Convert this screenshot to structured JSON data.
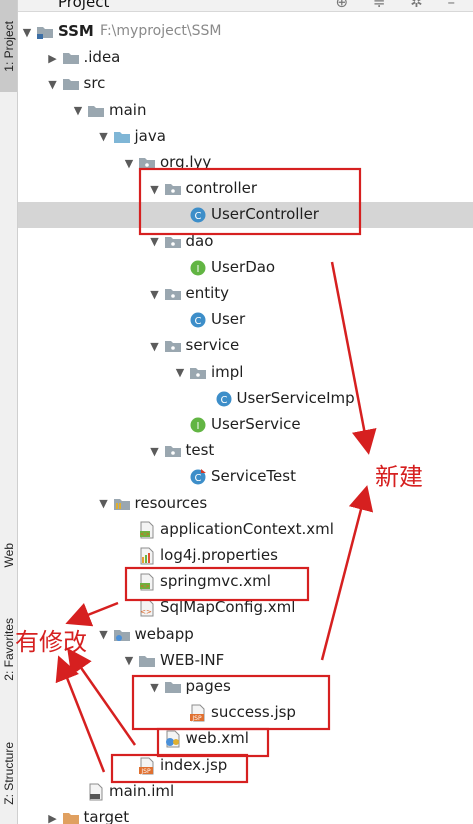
{
  "sidebar": {
    "tabs": [
      {
        "label": "1: Project",
        "icon": "folder-icon",
        "active": true
      },
      {
        "label": "Web",
        "icon": "web-icon",
        "active": false
      },
      {
        "label": "2: Favorites",
        "icon": "star-icon",
        "active": false
      },
      {
        "label": "Z: Structure",
        "icon": "structure-icon",
        "active": false
      }
    ]
  },
  "header": {
    "title": "Project",
    "icons": [
      "locate-icon",
      "collapse-icon",
      "gear-icon",
      "hide-icon"
    ]
  },
  "tree": [
    {
      "label": "SSM",
      "path": "F:\\myproject\\SSM",
      "icon": "module-folder-icon",
      "expanded": true,
      "bold": true
    },
    {
      "label": ".idea",
      "icon": "folder-icon",
      "expanded": false
    },
    {
      "label": "src",
      "icon": "folder-icon",
      "expanded": true
    },
    {
      "label": "main",
      "icon": "folder-icon",
      "expanded": true
    },
    {
      "label": "java",
      "icon": "source-folder-icon",
      "expanded": true
    },
    {
      "label": "org.lyy",
      "icon": "package-icon",
      "expanded": true
    },
    {
      "label": "controller",
      "icon": "package-icon",
      "expanded": true
    },
    {
      "label": "UserController",
      "icon": "class-icon",
      "selected": true
    },
    {
      "label": "dao",
      "icon": "package-icon",
      "expanded": true
    },
    {
      "label": "UserDao",
      "icon": "interface-icon"
    },
    {
      "label": "entity",
      "icon": "package-icon",
      "expanded": true
    },
    {
      "label": "User",
      "icon": "class-icon"
    },
    {
      "label": "service",
      "icon": "package-icon",
      "expanded": true
    },
    {
      "label": "impl",
      "icon": "package-icon",
      "expanded": true
    },
    {
      "label": "UserServiceImp",
      "icon": "class-icon"
    },
    {
      "label": "UserService",
      "icon": "interface-icon"
    },
    {
      "label": "test",
      "icon": "package-icon",
      "expanded": true
    },
    {
      "label": "ServiceTest",
      "icon": "test-class-icon"
    },
    {
      "label": "resources",
      "icon": "resources-folder-icon",
      "expanded": true
    },
    {
      "label": "applicationContext.xml",
      "icon": "spring-xml-icon"
    },
    {
      "label": "log4j.properties",
      "icon": "properties-icon"
    },
    {
      "label": "springmvc.xml",
      "icon": "spring-xml-icon"
    },
    {
      "label": "SqlMapConfig.xml",
      "icon": "xml-icon"
    },
    {
      "label": "webapp",
      "icon": "web-folder-icon",
      "expanded": true
    },
    {
      "label": "WEB-INF",
      "icon": "folder-icon",
      "expanded": true
    },
    {
      "label": "pages",
      "icon": "folder-icon",
      "expanded": true
    },
    {
      "label": "success.jsp",
      "icon": "jsp-icon"
    },
    {
      "label": "web.xml",
      "icon": "web-xml-icon"
    },
    {
      "label": "index.jsp",
      "icon": "jsp-icon"
    },
    {
      "label": "main.iml",
      "icon": "iml-icon"
    },
    {
      "label": "target",
      "icon": "excluded-folder-icon",
      "expanded": false
    }
  ],
  "annotations": {
    "new_label": "新建",
    "modified_label": "有修改",
    "color": "#d62020"
  },
  "colors": {
    "folder": "#9aa7b0",
    "source_folder": "#7fb6d6",
    "class": "#3d8ec9",
    "interface": "#62b543",
    "selection": "#d5d5d5"
  }
}
